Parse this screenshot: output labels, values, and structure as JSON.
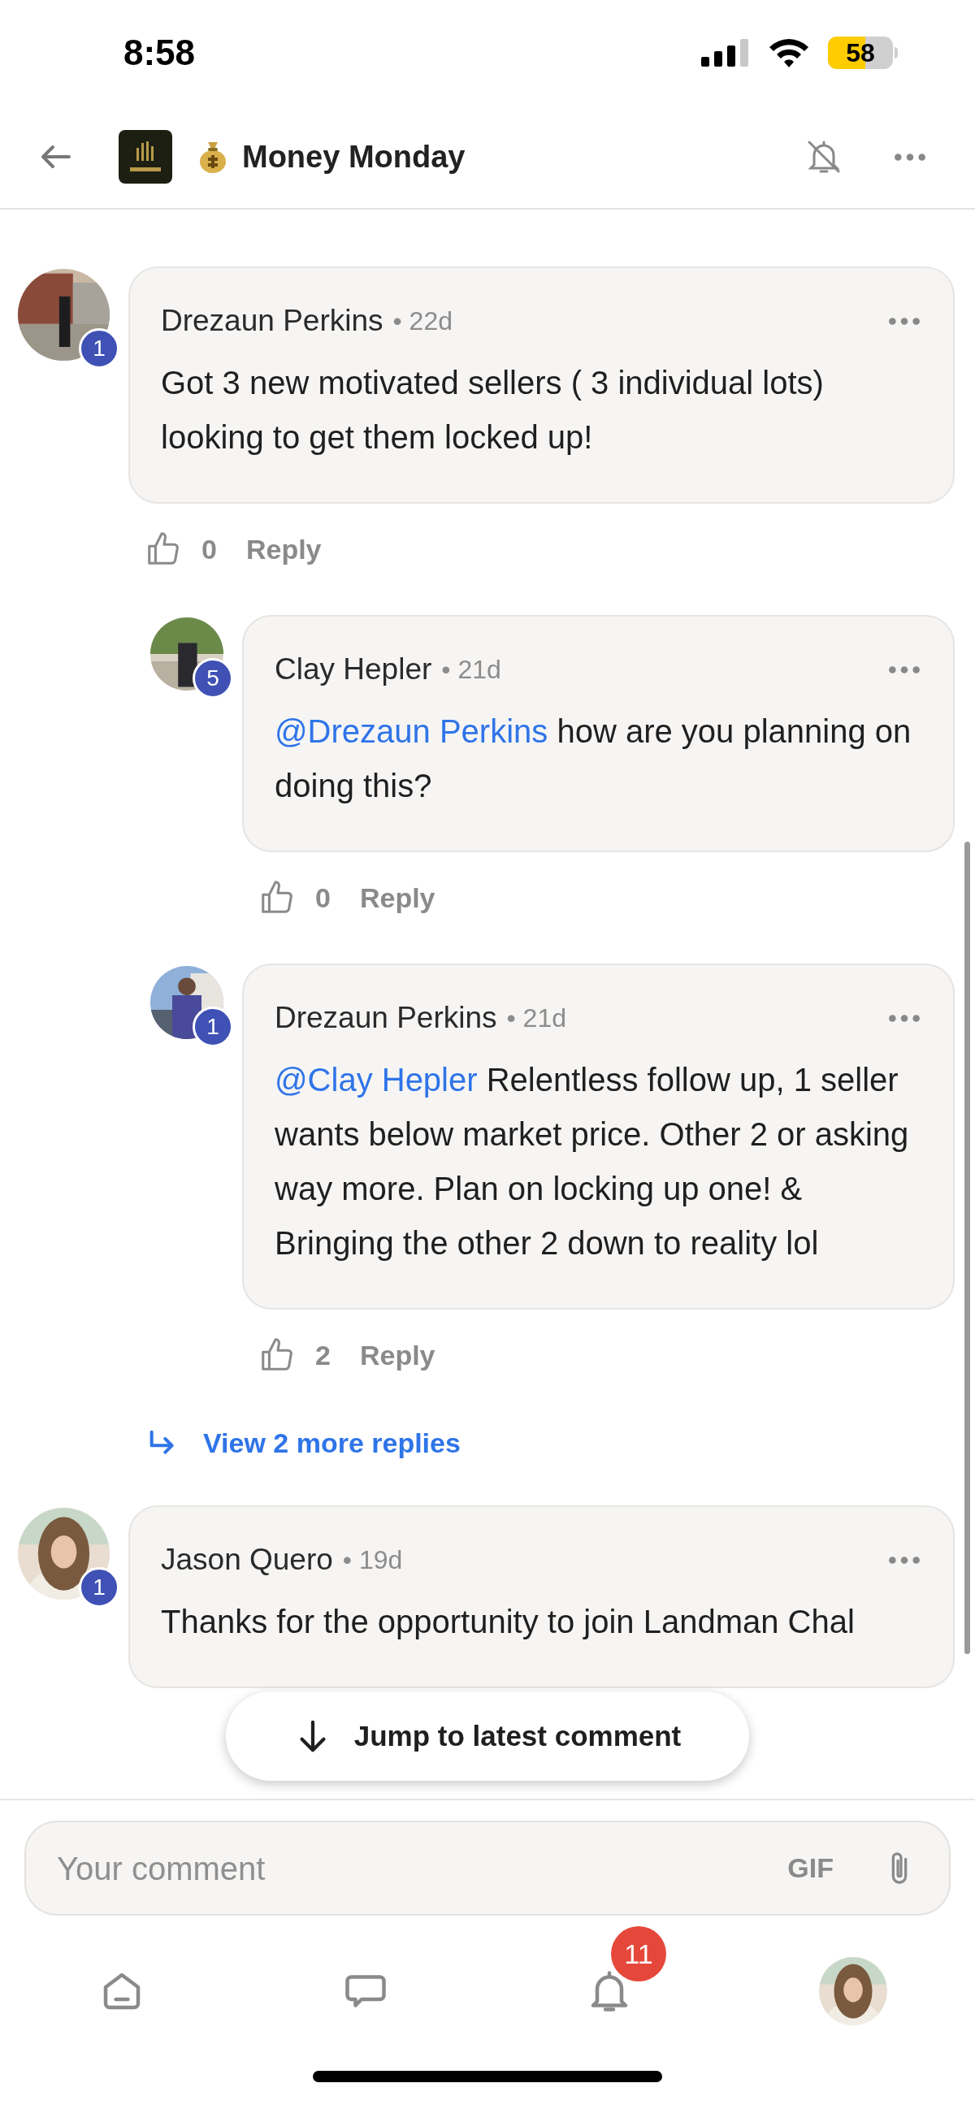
{
  "status_bar": {
    "time": "8:58",
    "battery": "58"
  },
  "header": {
    "title": "Money Monday"
  },
  "comments": [
    {
      "author": "Drezaun Perkins",
      "age": "• 22d",
      "badge": "1",
      "body": {
        "text": "Got 3 new motivated sellers ( 3 individual lots) looking to get them locked up!"
      },
      "likes": "0",
      "reply": "Reply",
      "children": [
        {
          "author": "Clay Hepler",
          "age": "• 21d",
          "badge": "5",
          "body": {
            "mention": "@Drezaun Perkins",
            "text": " how are you planning on doing this?"
          },
          "likes": "0",
          "reply": "Reply"
        },
        {
          "author": "Drezaun Perkins",
          "age": "• 21d",
          "badge": "1",
          "body": {
            "mention": "@Clay Hepler",
            "text": " Relentless follow up, 1 seller wants below market price. Other 2 or asking way more. Plan on locking up one! & Bringing the other 2 down to reality lol"
          },
          "likes": "2",
          "reply": "Reply"
        }
      ],
      "more_replies": "View 2 more replies"
    },
    {
      "author": "Jason Quero",
      "age": "• 19d",
      "badge": "1",
      "body": {
        "text": "Thanks for the opportunity to join Landman Chal"
      }
    }
  ],
  "jump_button": "Jump to latest comment",
  "composer": {
    "placeholder": "Your comment",
    "gif": "GIF"
  },
  "nav": {
    "notifications_badge": "11"
  }
}
